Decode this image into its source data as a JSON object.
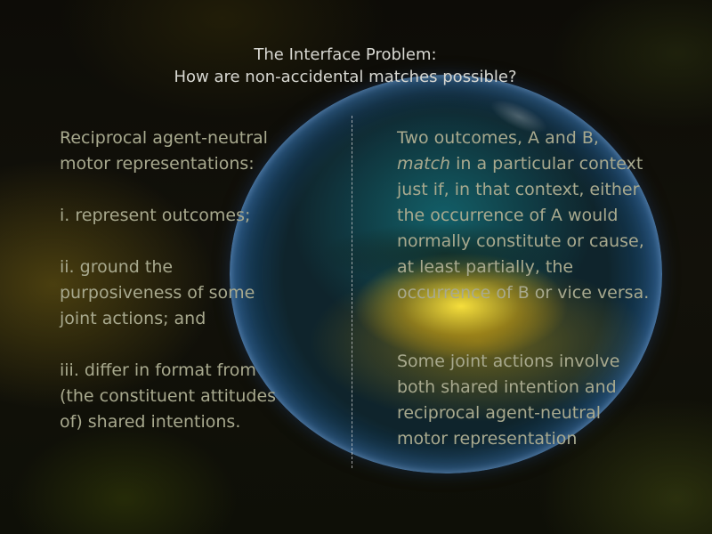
{
  "slide": {
    "title_line1": "The Interface Problem:",
    "title_line2": "How are non-accidental matches possible?",
    "left": {
      "intro_line1": "Reciprocal agent-neutral",
      "intro_line2": "motor representations:",
      "item1": "i. represent outcomes;",
      "item2_line1": "ii. ground the",
      "item2_line2": "purposiveness of some",
      "item2_line3": "joint actions; and",
      "item3_line1": "iii. differ in format from",
      "item3_line2": "(the constituent attitudes",
      "item3_line3": "of) shared intentions."
    },
    "right": {
      "def_line1": "Two  outcomes, A and B,",
      "def_line2_em": "match",
      "def_line2_rest": " in a particular context",
      "def_line3": "just if, in that context, either",
      "def_line4": "the occurrence of A would",
      "def_line5": "normally constitute or cause,",
      "def_line6": "at least partially, the",
      "def_line7": "occurrence of B or vice versa.",
      "claim_line1": "Some joint actions involve",
      "claim_line2": "both shared  intention and",
      "claim_line3": "reciprocal agent-neutral",
      "claim_line4": "motor representation"
    },
    "colors": {
      "title": "#d8d8d2",
      "body": "#a8a98e",
      "bubble_rim": "#4a78c0",
      "bubble_glow": "#f0d030"
    }
  }
}
